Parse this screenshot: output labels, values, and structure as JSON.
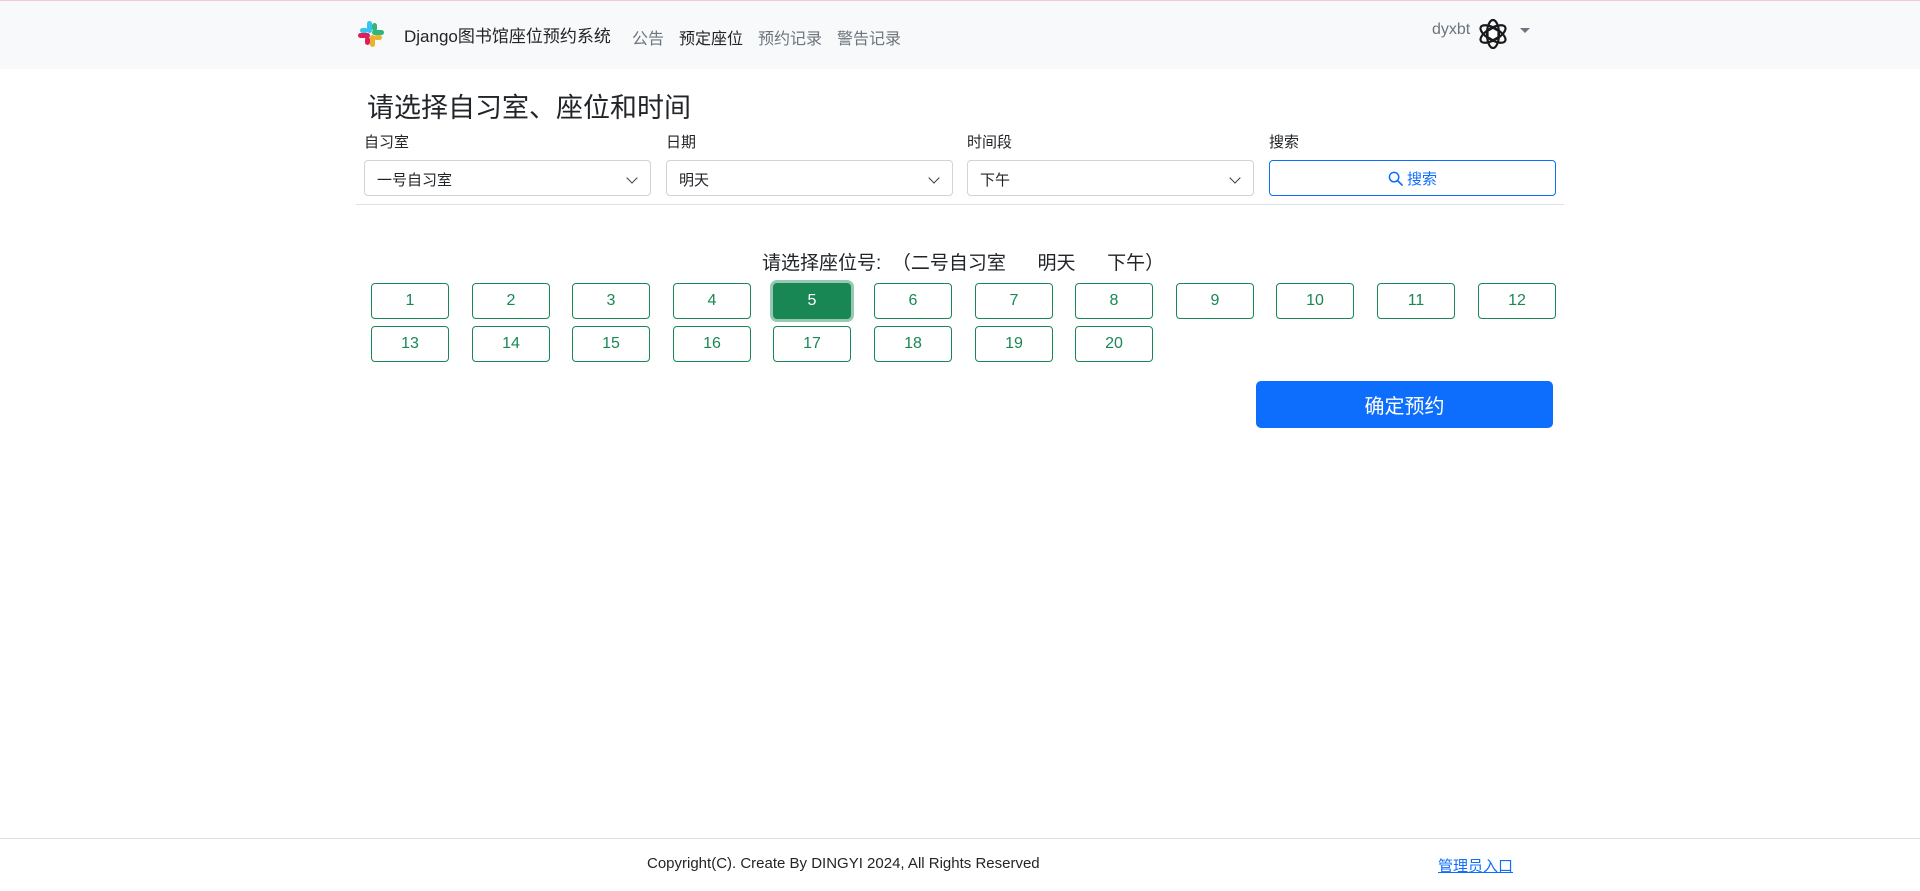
{
  "header": {
    "brand_title": "Django图书馆座位预约系统",
    "logo_icon": "slack-logo-icon",
    "nav": [
      "公告",
      "预定座位",
      "预约记录",
      "警告记录"
    ],
    "active_nav": "预定座位",
    "user_name": "dyxbt",
    "avatar_icon": "openai-logo-icon"
  },
  "page_title": "请选择自习室、座位和时间",
  "filters": {
    "room": {
      "label": "自习室",
      "value": "一号自习室"
    },
    "date": {
      "label": "日期",
      "value": "明天"
    },
    "period": {
      "label": "时间段",
      "value": "下午"
    },
    "search": {
      "label": "搜索",
      "button": "搜索"
    }
  },
  "seat_section": {
    "heading": "请选择座位号:  （二号自习室      明天      下午）",
    "seats": [
      "1",
      "2",
      "3",
      "4",
      "5",
      "6",
      "7",
      "8",
      "9",
      "10",
      "11",
      "12",
      "13",
      "14",
      "15",
      "16",
      "17",
      "18",
      "19",
      "20"
    ],
    "selected_seat": "5"
  },
  "confirm_button": "确定预约",
  "footer": {
    "copyright": "Copyright(C). Create By DINGYI 2024, All Rights Reserved",
    "admin_link": "管理员入口"
  },
  "colors": {
    "primary": "#0d6efd",
    "success": "#198754",
    "navbar_bg": "#f8f9fa"
  }
}
